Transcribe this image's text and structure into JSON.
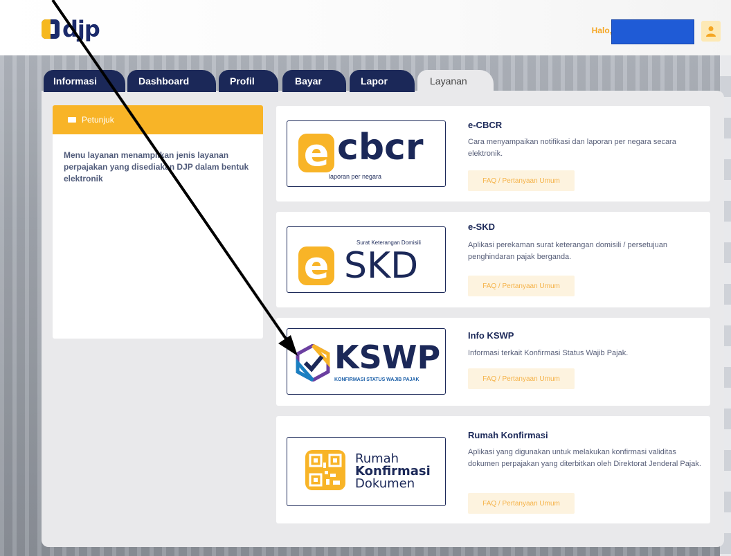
{
  "header": {
    "logo_text": "djp",
    "greeting": "Halo,"
  },
  "tabs": [
    {
      "label": "Informasi"
    },
    {
      "label": "Dashboard"
    },
    {
      "label": "Profil"
    },
    {
      "label": "Bayar"
    },
    {
      "label": "Lapor"
    },
    {
      "label": "Layanan"
    }
  ],
  "guide": {
    "title": "Petunjuk",
    "text": "Menu layanan menampilkan jenis layanan perpajakan yang disediakan DJP dalam bentuk elektronik"
  },
  "services": [
    {
      "title": "e-CBCR",
      "description": "Cara menyampaikan notifikasi dan laporan per negara secara elektronik.",
      "faq_label": "FAQ / Pertanyaan Umum",
      "logo_word": "cbcr",
      "logo_sub": "laporan per negara"
    },
    {
      "title": "e-SKD",
      "description": "Aplikasi perekaman surat keterangan domisili / persetujuan penghindaran pajak berganda.",
      "faq_label": "FAQ / Pertanyaan Umum",
      "logo_word": "SKD",
      "logo_sub": "Surat Keterangan Domisili"
    },
    {
      "title": "Info KSWP",
      "description": "Informasi terkait Konfirmasi Status Wajib Pajak.",
      "faq_label": "FAQ / Pertanyaan Umum",
      "logo_word": "KSWP",
      "logo_sub": "KONFIRMASI STATUS WAJIB PAJAK"
    },
    {
      "title": "Rumah Konfirmasi",
      "description": "Aplikasi yang digunakan untuk melakukan konfirmasi validitas dokumen perpajakan yang diterbitkan oleh Direktorat Jenderal Pajak.",
      "faq_label": "FAQ / Pertanyaan Umum",
      "logo_line1": "Rumah",
      "logo_line2": "Konfirmasi",
      "logo_line3": "Dokumen"
    }
  ],
  "logo_e_letter": "e",
  "colors": {
    "navy": "#1b2858",
    "accent": "#f8b427",
    "user_highlight": "#1f5bd6"
  },
  "icons": {
    "user": "user-icon",
    "guide": "book-icon",
    "annotation": "annotation-arrow"
  }
}
